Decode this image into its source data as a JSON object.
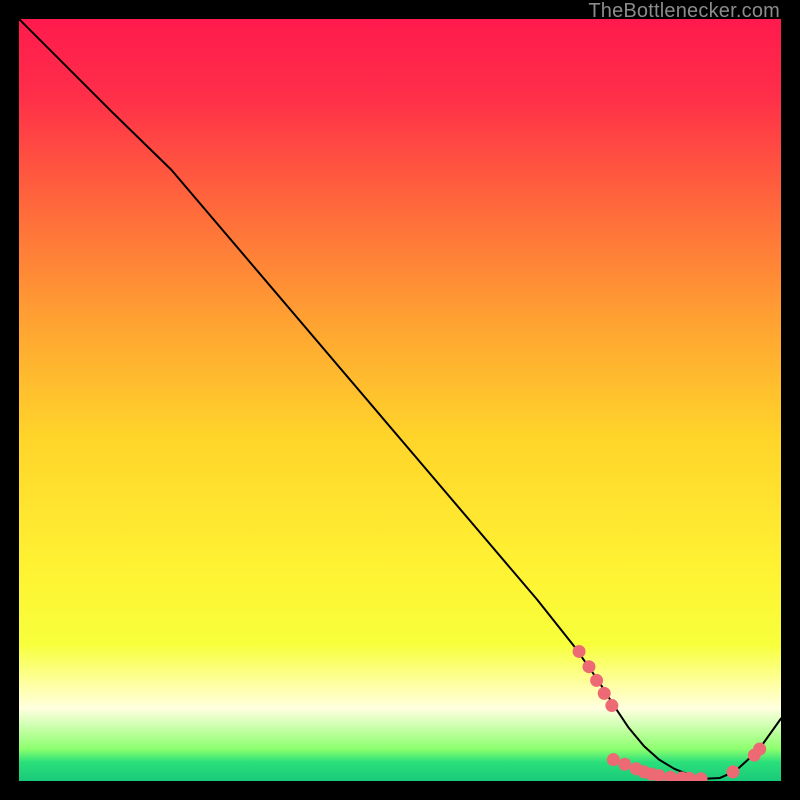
{
  "watermark": "TheBottlenecker.com",
  "chart_data": {
    "type": "line",
    "title": "",
    "xlabel": "",
    "ylabel": "",
    "xlim": [
      0,
      100
    ],
    "ylim": [
      0,
      100
    ],
    "grid": false,
    "background_gradient": {
      "stops": [
        {
          "pos": 0.0,
          "color": "#ff1a4d"
        },
        {
          "pos": 0.1,
          "color": "#ff2e49"
        },
        {
          "pos": 0.25,
          "color": "#ff6a3b"
        },
        {
          "pos": 0.4,
          "color": "#ffa332"
        },
        {
          "pos": 0.55,
          "color": "#ffd52a"
        },
        {
          "pos": 0.72,
          "color": "#fff233"
        },
        {
          "pos": 0.82,
          "color": "#f7ff3a"
        },
        {
          "pos": 0.88,
          "color": "#ffffb0"
        },
        {
          "pos": 0.905,
          "color": "#ffffe0"
        },
        {
          "pos": 0.958,
          "color": "#8cff6e"
        },
        {
          "pos": 0.975,
          "color": "#2be07a"
        },
        {
          "pos": 1.0,
          "color": "#19c97a"
        }
      ]
    },
    "series": [
      {
        "name": "curve",
        "stroke": "#000000",
        "stroke_width": 2,
        "x": [
          0,
          4,
          8,
          12,
          20,
          28,
          36,
          44,
          52,
          60,
          68,
          73,
          76,
          78,
          80,
          82,
          84,
          86,
          88,
          90,
          92,
          94,
          97,
          100
        ],
        "y": [
          100,
          96,
          92,
          88,
          80.2,
          70.8,
          61.4,
          52.0,
          42.6,
          33.2,
          23.8,
          17.5,
          13.2,
          10.0,
          7.0,
          4.6,
          2.8,
          1.6,
          0.8,
          0.3,
          0.4,
          1.3,
          4.0,
          8.2
        ]
      }
    ],
    "markers": [
      {
        "x": 73.5,
        "y": 17.0
      },
      {
        "x": 74.8,
        "y": 15.0
      },
      {
        "x": 75.8,
        "y": 13.2
      },
      {
        "x": 76.8,
        "y": 11.5
      },
      {
        "x": 77.8,
        "y": 9.9
      },
      {
        "x": 78.0,
        "y": 2.8
      },
      {
        "x": 79.5,
        "y": 2.2
      },
      {
        "x": 81.0,
        "y": 1.6
      },
      {
        "x": 82.0,
        "y": 1.2
      },
      {
        "x": 83.0,
        "y": 0.9
      },
      {
        "x": 84.0,
        "y": 0.7
      },
      {
        "x": 85.5,
        "y": 0.5
      },
      {
        "x": 87.0,
        "y": 0.4
      },
      {
        "x": 88.0,
        "y": 0.35
      },
      {
        "x": 89.5,
        "y": 0.3
      },
      {
        "x": 93.7,
        "y": 1.2
      },
      {
        "x": 96.5,
        "y": 3.4
      },
      {
        "x": 97.2,
        "y": 4.2
      }
    ],
    "marker_style": {
      "fill": "#ed6a74",
      "radius": 6.5
    }
  }
}
